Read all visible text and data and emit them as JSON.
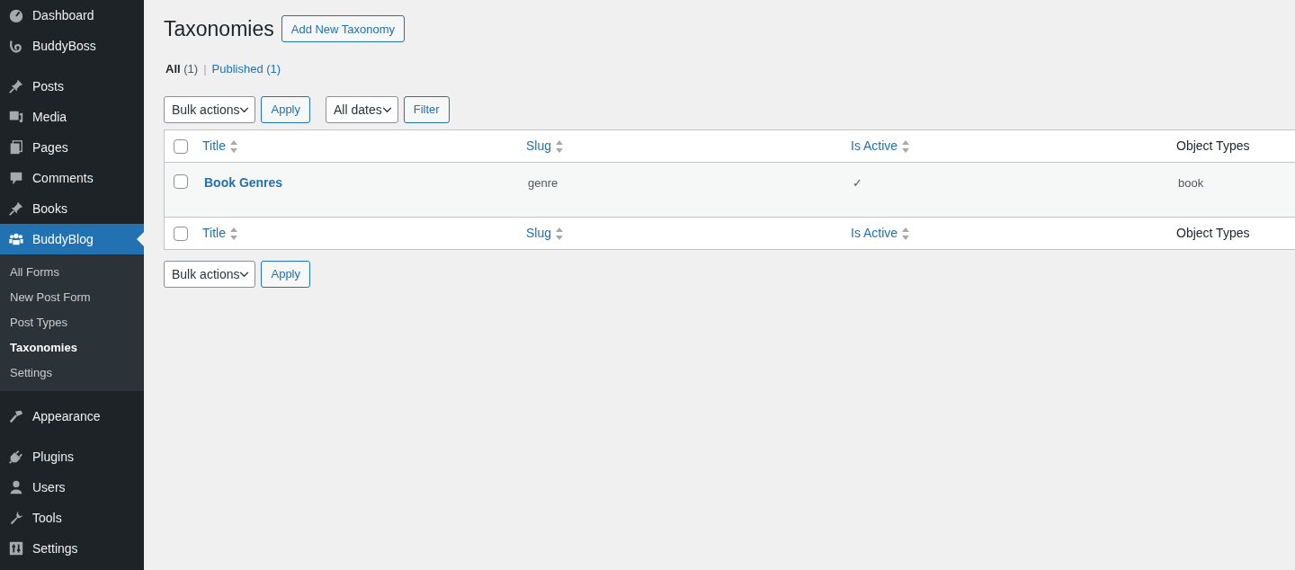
{
  "sidebar": {
    "groups": [
      [
        {
          "label": "Dashboard",
          "selected": false
        },
        {
          "label": "BuddyBoss",
          "selected": false
        }
      ],
      [
        {
          "label": "Posts",
          "selected": false
        },
        {
          "label": "Media",
          "selected": false
        },
        {
          "label": "Pages",
          "selected": false
        },
        {
          "label": "Comments",
          "selected": false
        },
        {
          "label": "Books",
          "selected": false
        },
        {
          "label": "BuddyBlog",
          "selected": true,
          "children": [
            {
              "label": "All Forms",
              "selected": false
            },
            {
              "label": "New Post Form",
              "selected": false
            },
            {
              "label": "Post Types",
              "selected": false
            },
            {
              "label": "Taxonomies",
              "selected": true
            },
            {
              "label": "Settings",
              "selected": false
            }
          ]
        }
      ],
      [
        {
          "label": "Appearance",
          "selected": false
        }
      ],
      [
        {
          "label": "Plugins",
          "selected": false
        },
        {
          "label": "Users",
          "selected": false
        },
        {
          "label": "Tools",
          "selected": false
        },
        {
          "label": "Settings",
          "selected": false
        }
      ]
    ]
  },
  "page": {
    "title": "Taxonomies",
    "add_button": "Add New Taxonomy"
  },
  "views": [
    {
      "label": "All",
      "count": "(1)",
      "selected": true
    },
    {
      "separator": "|",
      "label": "Published",
      "count": "(1)",
      "selected": false
    }
  ],
  "top_actions": {
    "bulk": "Bulk actions",
    "apply": "Apply",
    "dates": "All dates",
    "filter": "Filter"
  },
  "table": {
    "header": {
      "checked": false,
      "columns": [
        {
          "label": "Title",
          "sortable": true
        },
        {
          "label": "Slug",
          "sortable": true
        },
        {
          "label": "Is Active",
          "sortable": true
        },
        {
          "label": "Object Types",
          "sortable": false
        }
      ]
    },
    "footer": {
      "checked": false,
      "columns": [
        {
          "label": "Title",
          "sortable": true
        },
        {
          "label": "Slug",
          "sortable": true
        },
        {
          "label": "Is Active",
          "sortable": true
        },
        {
          "label": "Object Types",
          "sortable": false
        }
      ]
    },
    "rows": [
      {
        "checked": false,
        "cells": [
          "Book Genres",
          "genre",
          "✓",
          "book"
        ]
      }
    ]
  },
  "bottom_actions": {
    "bulk": "Bulk actions",
    "apply": "Apply"
  }
}
